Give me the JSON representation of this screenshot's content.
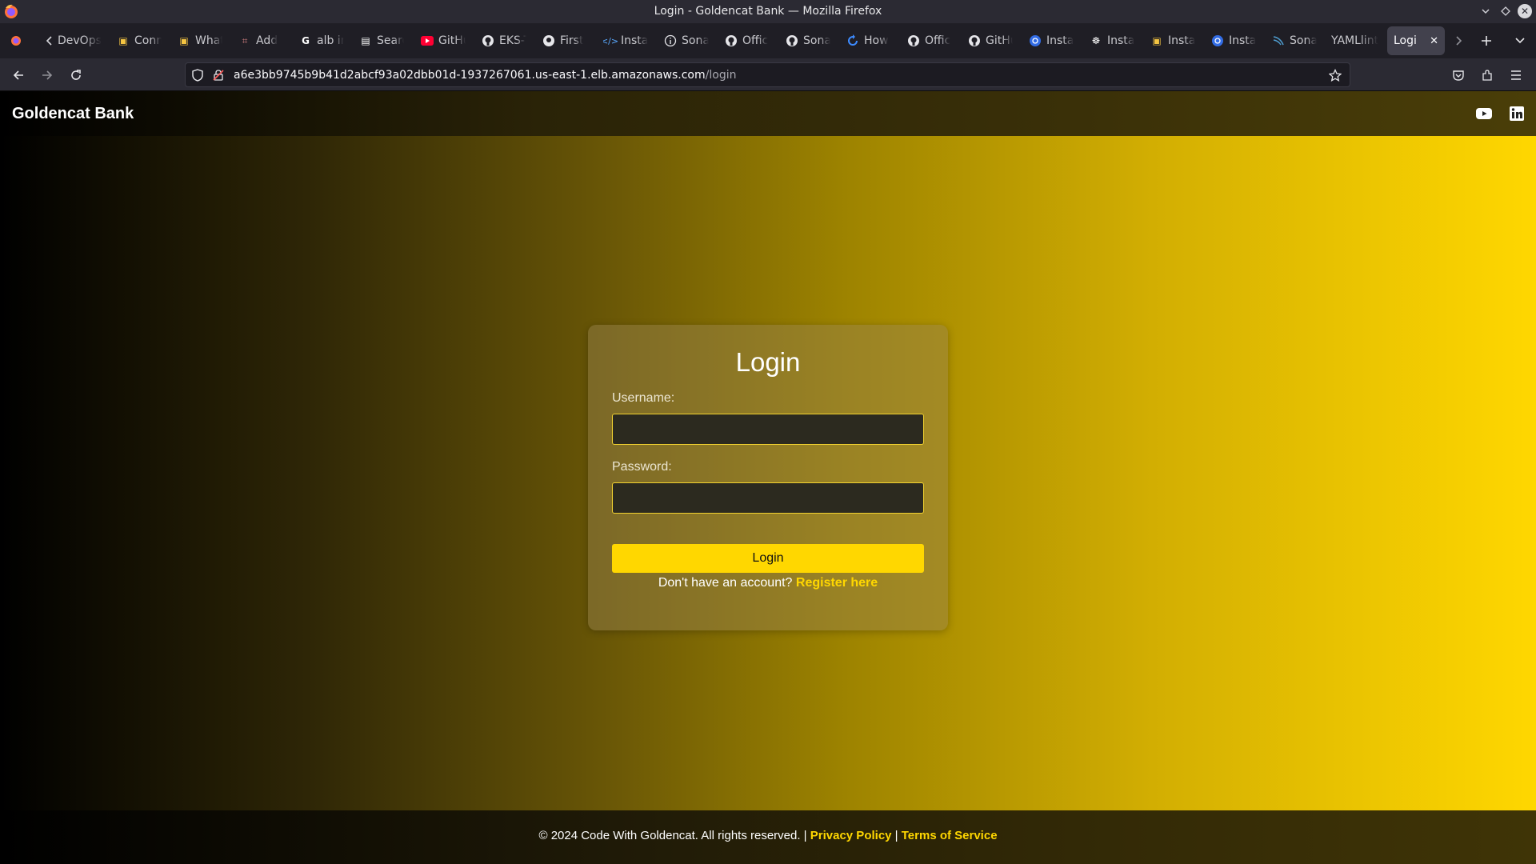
{
  "window": {
    "title": "Login - Goldencat Bank — Mozilla Firefox"
  },
  "tabs": [
    {
      "label": "DevOps",
      "icon": "devops-icon"
    },
    {
      "label": "Conn",
      "icon": "package-icon"
    },
    {
      "label": "What",
      "icon": "package-icon"
    },
    {
      "label": "Add",
      "icon": "aws-icon"
    },
    {
      "label": "alb in",
      "icon": "google-icon"
    },
    {
      "label": "Searc",
      "icon": "search-site-icon"
    },
    {
      "label": "GitHu",
      "icon": "youtube-icon"
    },
    {
      "label": "EKS-T",
      "icon": "github-icon"
    },
    {
      "label": "First",
      "icon": "octopus-icon"
    },
    {
      "label": "Insta",
      "icon": "code-icon"
    },
    {
      "label": "Sona",
      "icon": "info-icon"
    },
    {
      "label": "Offic",
      "icon": "github-icon"
    },
    {
      "label": "Sona",
      "icon": "github-icon"
    },
    {
      "label": "How",
      "icon": "refresh-blue-icon"
    },
    {
      "label": "Offic",
      "icon": "github-icon"
    },
    {
      "label": "GitHu",
      "icon": "github-icon"
    },
    {
      "label": "Insta",
      "icon": "kubernetes-icon"
    },
    {
      "label": "Insta",
      "icon": "helm-icon"
    },
    {
      "label": "Insta",
      "icon": "package-icon"
    },
    {
      "label": "Insta",
      "icon": "kubernetes-icon"
    },
    {
      "label": "Sona",
      "icon": "sonar-icon"
    },
    {
      "label": "YAMLlint",
      "icon": ""
    },
    {
      "label": "Login",
      "icon": "",
      "active": true
    }
  ],
  "urlbar": {
    "host": "a6e3bb9745b9b41d2abcf93a02dbb01d-1937267061.us-east-1.elb.amazonaws.com",
    "path": "/login"
  },
  "site": {
    "brand": "Goldencat Bank",
    "social": [
      "youtube-icon",
      "linkedin-icon"
    ]
  },
  "login": {
    "title": "Login",
    "username_label": "Username:",
    "username_value": "",
    "password_label": "Password:",
    "password_value": "",
    "submit_label": "Login",
    "register_prompt": "Don't have an account?",
    "register_link": "Register here"
  },
  "footer": {
    "copyright": "© 2024 Code With Goldencat. All rights reserved. |",
    "privacy": "Privacy Policy",
    "separator": "|",
    "terms": "Terms of Service"
  },
  "colors": {
    "accent": "#ffd700",
    "chrome_dark": "#2b2a33"
  }
}
